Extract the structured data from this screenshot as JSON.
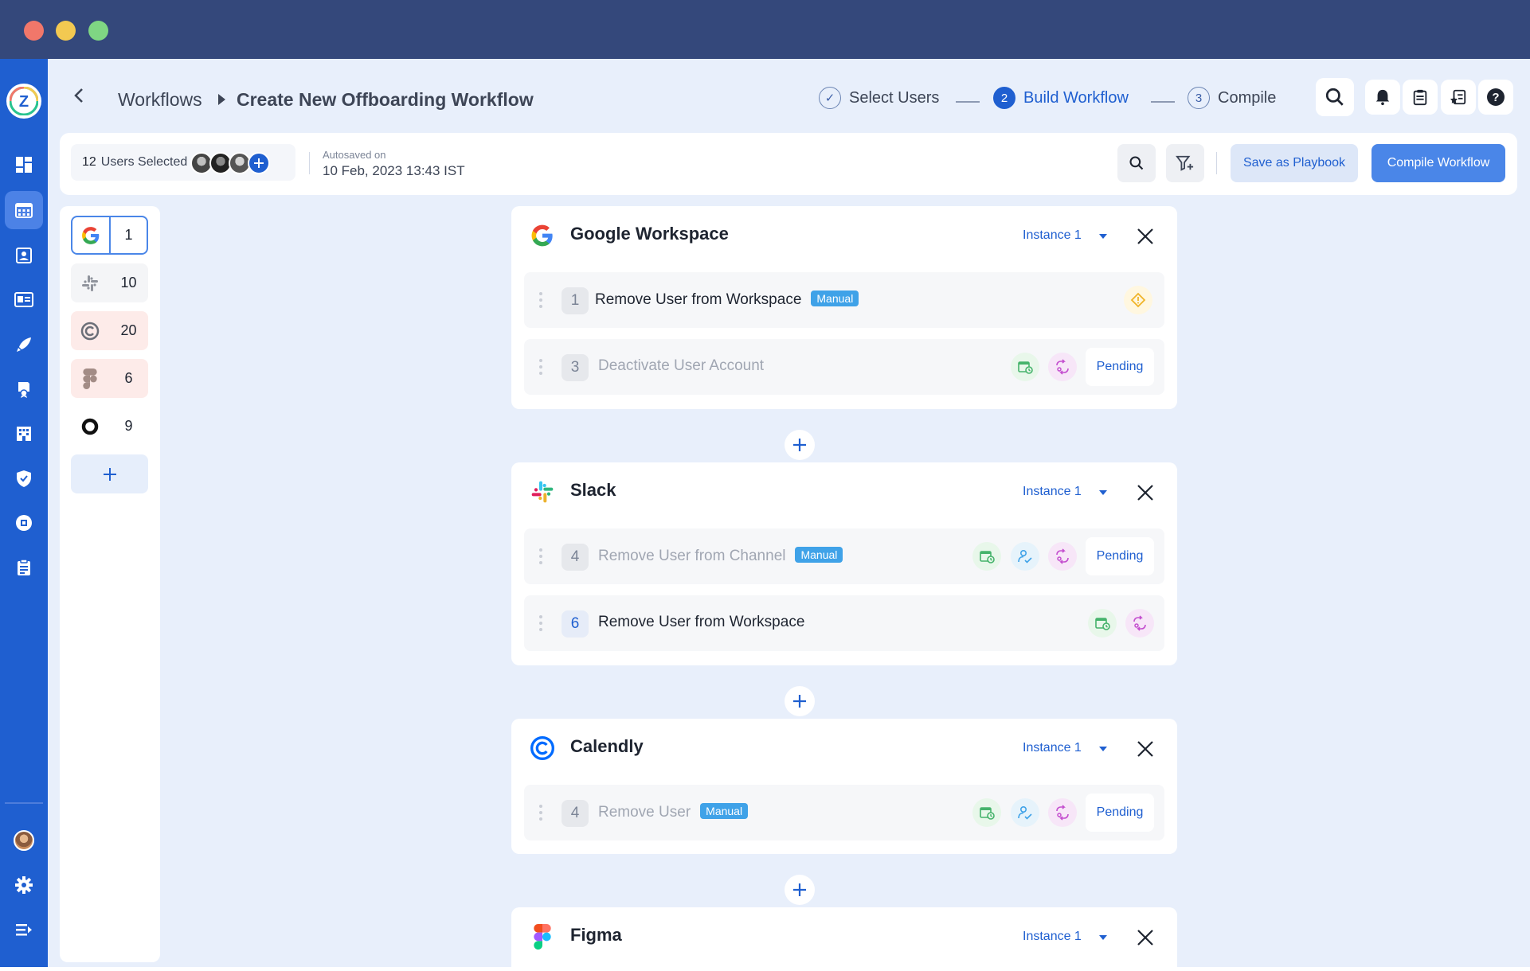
{
  "header": {
    "breadcrumb_parent": "Workflows",
    "breadcrumb_current": "Create New Offboarding Workflow",
    "steps": [
      {
        "number": "✓",
        "label": "Select Users"
      },
      {
        "number": "2",
        "label": "Build Workflow"
      },
      {
        "number": "3",
        "label": "Compile"
      }
    ],
    "icons": [
      "search-icon",
      "bell-icon",
      "clipboard-icon",
      "review-icon",
      "help-icon"
    ]
  },
  "toolbar": {
    "users_count": "12",
    "users_label": "Users Selected",
    "autosave_label": "Autosaved on",
    "autosave_value": "10 Feb, 2023  13:43  IST",
    "save_playbook": "Save as Playbook",
    "compile": "Compile Workflow"
  },
  "app_list": [
    {
      "name": "google-workspace",
      "count": "1"
    },
    {
      "name": "slack",
      "count": "10"
    },
    {
      "name": "calendly",
      "count": "20"
    },
    {
      "name": "figma",
      "count": "6"
    },
    {
      "name": "other-app",
      "count": "9"
    }
  ],
  "cards": [
    {
      "title": "Google Workspace",
      "instance": "Instance 1",
      "tasks": [
        {
          "number": "1",
          "name": "Remove User from Workspace",
          "badge": "Manual"
        },
        {
          "number": "3",
          "name": "Deactivate User Account",
          "status": "Pending"
        }
      ]
    },
    {
      "title": "Slack",
      "instance": "Instance 1",
      "tasks": [
        {
          "number": "4",
          "name": "Remove User from Channel",
          "badge": "Manual",
          "status": "Pending"
        },
        {
          "number": "6",
          "name": "Remove User from Workspace"
        }
      ]
    },
    {
      "title": "Calendly",
      "instance": "Instance 1",
      "tasks": [
        {
          "number": "4",
          "name": "Remove User",
          "badge": "Manual",
          "status": "Pending"
        }
      ]
    },
    {
      "title": "Figma",
      "instance": "Instance 1",
      "tasks": []
    }
  ],
  "colors": {
    "accent": "#1f5fd0",
    "titlebar": "#34487b",
    "background": "#e8effb",
    "badge": "#3fa2e8"
  }
}
